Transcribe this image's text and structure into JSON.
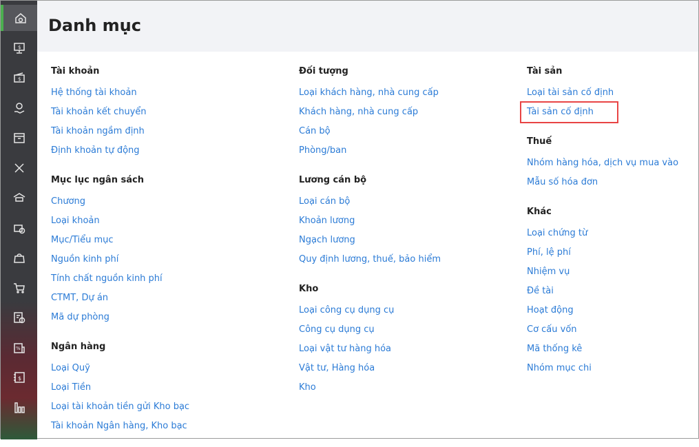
{
  "header": {
    "title": "Danh mục"
  },
  "sidebar": {
    "items": [
      "home-icon",
      "monitor-dollar-icon",
      "wallet-icon",
      "hand-coin-icon",
      "box-icon",
      "tools-icon",
      "garage-icon",
      "briefcase-dollar-icon",
      "bag-icon",
      "cart-icon",
      "invoice-dollar-icon",
      "percent-icon",
      "ledger-dollar-icon",
      "bar-chart-icon"
    ]
  },
  "columns": [
    [
      {
        "title": "Tài khoản",
        "items": [
          "Hệ thống tài khoản",
          "Tài khoản kết chuyển",
          "Tài khoản ngầm định",
          "Định khoản tự động"
        ]
      },
      {
        "title": "Mục lục ngân sách",
        "items": [
          "Chương",
          "Loại khoản",
          "Mục/Tiểu mục",
          "Nguồn kinh phí",
          "Tính chất nguồn kinh phí",
          "CTMT, Dự án",
          "Mã dự phòng"
        ]
      },
      {
        "title": "Ngân hàng",
        "items": [
          "Loại Quỹ",
          "Loại Tiền",
          "Loại tài khoản tiền gửi Kho bạc",
          "Tài khoản Ngân hàng, Kho bạc"
        ]
      }
    ],
    [
      {
        "title": "Đối tượng",
        "items": [
          "Loại khách hàng, nhà cung cấp",
          "Khách hàng, nhà cung cấp",
          "Cán bộ",
          "Phòng/ban"
        ]
      },
      {
        "title": "Lương cán bộ",
        "items": [
          "Loại cán bộ",
          "Khoản lương",
          "Ngạch lương",
          "Quy định lương, thuế, bảo hiểm"
        ]
      },
      {
        "title": "Kho",
        "items": [
          "Loại công cụ dụng cụ",
          "Công cụ dụng cụ",
          "Loại vật tư hàng hóa",
          "Vật tư, Hàng hóa",
          "Kho"
        ]
      }
    ],
    [
      {
        "title": "Tài sản",
        "items": [
          "Loại tài sản cố định",
          "Tài sản cố định"
        ]
      },
      {
        "title": "Thuế",
        "items": [
          "Nhóm hàng hóa, dịch vụ mua vào",
          "Mẫu số hóa đơn"
        ]
      },
      {
        "title": "Khác",
        "items": [
          "Loại chứng từ",
          "Phí, lệ phí",
          "Nhiệm vụ",
          "Đề tài",
          "Hoạt động",
          "Cơ cấu vốn",
          "Mã thống kê",
          "Nhóm mục chi"
        ]
      }
    ]
  ],
  "colors": {
    "sidebar": "#3a3b3f",
    "link": "#2b7bd6",
    "accent": "#4caf50",
    "highlight": "#e84444"
  }
}
